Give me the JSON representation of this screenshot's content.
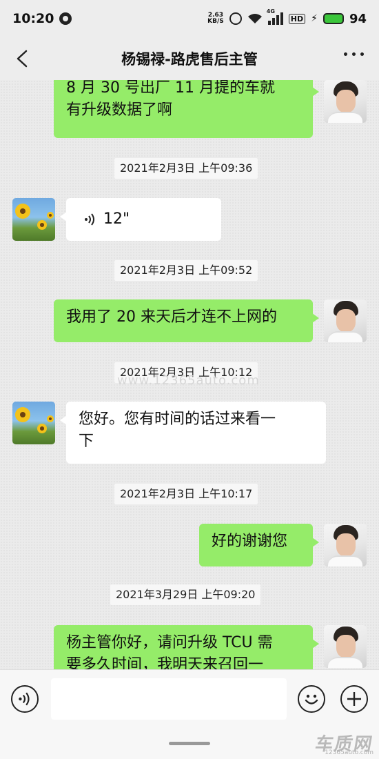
{
  "status_bar": {
    "time": "10:20",
    "net_speed_value": "2.63",
    "net_speed_unit": "KB/S",
    "network": "4G",
    "hd": "HD",
    "battery": "94"
  },
  "header": {
    "title": "杨锡禄-路虎售后主管"
  },
  "messages": [
    {
      "sender": "me",
      "text_line1": "8 月 30 号出厂 11 月提的车就",
      "text_line2": "有升级数据了啊"
    },
    {
      "timestamp": "2021年2月3日 上午09:36"
    },
    {
      "sender": "other",
      "type": "voice",
      "duration": "12\""
    },
    {
      "timestamp": "2021年2月3日 上午09:52"
    },
    {
      "sender": "me",
      "text": "我用了 20 来天后才连不上网的"
    },
    {
      "timestamp": "2021年2月3日 上午10:12"
    },
    {
      "sender": "other",
      "text_line1": "您好。您有时间的话过来看一",
      "text_line2": "下"
    },
    {
      "timestamp": "2021年2月3日 上午10:17"
    },
    {
      "sender": "me",
      "text": "好的谢谢您"
    },
    {
      "timestamp": "2021年3月29日 上午09:20"
    },
    {
      "sender": "me",
      "text_line1": "杨主管你好，请问升级 TCU 需",
      "text_line2": "要多久时间，我明天来召回一"
    }
  ],
  "watermark": {
    "center": "www.12365auto.com",
    "logo": "车质网",
    "logo_url": "12365auto.com"
  },
  "colors": {
    "my_bubble": "#95ec69",
    "other_bubble": "#ffffff",
    "background": "#ededed"
  }
}
